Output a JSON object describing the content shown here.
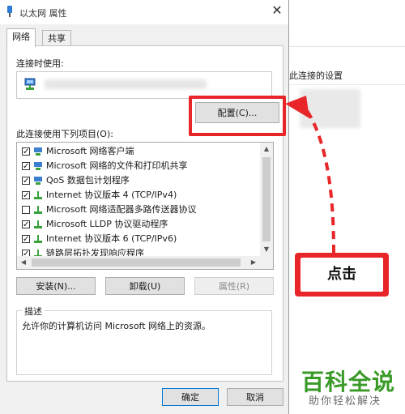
{
  "window": {
    "title": "以太网 属性",
    "close_glyph": "✕"
  },
  "tabs": [
    {
      "label": "网络",
      "active": true
    },
    {
      "label": "共享",
      "active": false
    }
  ],
  "connect_using": {
    "label": "连接时使用:",
    "configure_button": "配置(C)..."
  },
  "items_label": "此连接使用下列项目(O):",
  "items": [
    {
      "label": "Microsoft 网络客户端",
      "checked": true,
      "icon": "network-client-icon"
    },
    {
      "label": "Microsoft 网络的文件和打印机共享",
      "checked": true,
      "icon": "network-client-icon"
    },
    {
      "label": "QoS 数据包计划程序",
      "checked": true,
      "icon": "network-client-icon"
    },
    {
      "label": "Internet 协议版本 4 (TCP/IPv4)",
      "checked": true,
      "icon": "protocol-icon"
    },
    {
      "label": "Microsoft 网络适配器多路传送器协议",
      "checked": false,
      "icon": "protocol-icon"
    },
    {
      "label": "Microsoft LLDP 协议驱动程序",
      "checked": true,
      "icon": "protocol-icon"
    },
    {
      "label": "Internet 协议版本 6 (TCP/IPv6)",
      "checked": true,
      "icon": "protocol-icon"
    },
    {
      "label": "链路层拓扑发现响应程序",
      "checked": true,
      "icon": "protocol-icon"
    }
  ],
  "buttons": {
    "install": "安装(N)...",
    "uninstall": "卸载(U)",
    "properties": "属性(R)",
    "ok": "确定",
    "cancel": "取消"
  },
  "description": {
    "title": "描述",
    "text": "允许你的计算机访问 Microsoft 网络上的资源。"
  },
  "background": {
    "settings_text": "此连接的设置"
  },
  "annotation": {
    "callout_text": "点击",
    "color": "#e8262a"
  },
  "watermark": {
    "main": "百科全说",
    "sub": "助你轻松解决"
  }
}
